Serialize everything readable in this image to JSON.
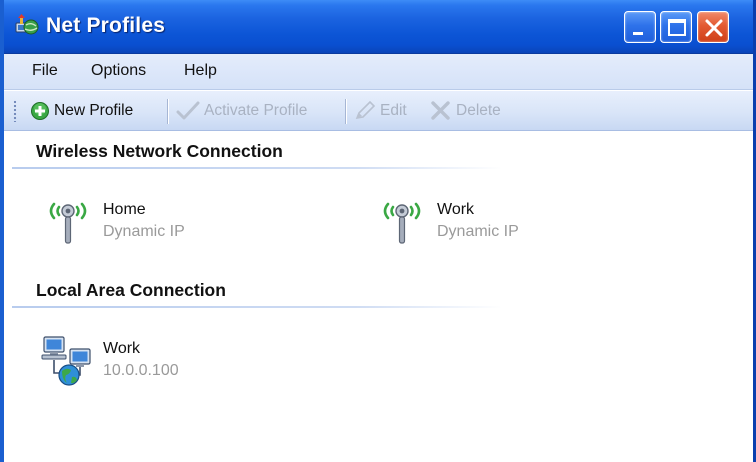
{
  "window": {
    "title": "Net Profiles"
  },
  "menu": {
    "file": "File",
    "options": "Options",
    "help": "Help"
  },
  "toolbar": {
    "new_profile": "New Profile",
    "activate_profile": "Activate Profile",
    "edit": "Edit",
    "delete": "Delete"
  },
  "groups": [
    {
      "title": "Wireless Network Connection",
      "profiles": [
        {
          "name": "Home",
          "detail": "Dynamic IP",
          "icon": "wireless-antenna-icon"
        },
        {
          "name": "Work",
          "detail": "Dynamic IP",
          "icon": "wireless-antenna-icon"
        }
      ]
    },
    {
      "title": "Local Area Connection",
      "profiles": [
        {
          "name": "Work",
          "detail": "10.0.0.100",
          "icon": "network-computers-icon"
        }
      ]
    }
  ],
  "colors": {
    "titlebar": "#0c55d6",
    "menubar": "#d5e2f8",
    "disabled_text": "#a9b2c2",
    "detail_text": "#9a9a9a",
    "close_button": "#e35a32"
  }
}
